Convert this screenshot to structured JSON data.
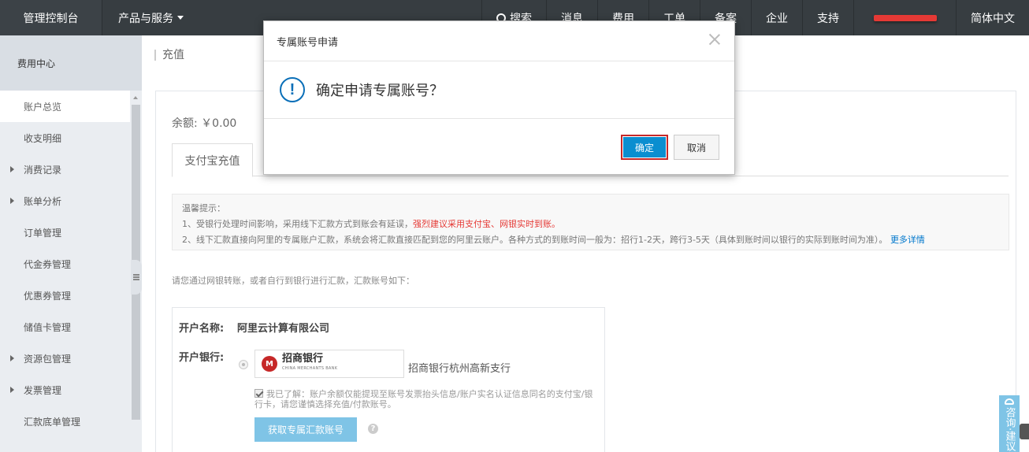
{
  "topbar": {
    "brand": "管理控制台",
    "products": "产品与服务",
    "search": "搜索",
    "items": [
      "消息",
      "费用",
      "工单",
      "备案",
      "企业",
      "支持"
    ],
    "language": "简体中文"
  },
  "sidebar": {
    "title": "费用中心",
    "items": [
      {
        "label": "账户总览",
        "expandable": false,
        "active": true
      },
      {
        "label": "收支明细",
        "expandable": false
      },
      {
        "label": "消费记录",
        "expandable": true
      },
      {
        "label": "账单分析",
        "expandable": true
      },
      {
        "label": "订单管理",
        "expandable": false
      },
      {
        "label": "代金券管理",
        "expandable": false
      },
      {
        "label": "优惠券管理",
        "expandable": false
      },
      {
        "label": "储值卡管理",
        "expandable": false
      },
      {
        "label": "资源包管理",
        "expandable": true
      },
      {
        "label": "发票管理",
        "expandable": true
      },
      {
        "label": "汇款底单管理",
        "expandable": false
      }
    ]
  },
  "main": {
    "breadcrumb": "充值",
    "balance": "余额: ￥0.00",
    "tab": "支付宝充值",
    "notice": {
      "title": "温馨提示：",
      "line1_a": "1、受银行处理时间影响，采用线下汇款方式到账会有延误，",
      "line1_red": "强烈建议采用支付宝、网银实时到账。",
      "line2": "2、线下汇款直接向阿里的专属账户汇款，系统会将汇款直接匹配到您的阿里云账户。各种方式的到账时间一般为：招行1-2天，跨行3-5天（具体到账时间以银行的实际到账时间为准）。",
      "more": "更多详情"
    },
    "instruction": "请您通过网银转账，或者自行到银行进行汇款，汇款账号如下：",
    "account": {
      "name_label": "开户名称:",
      "name_value": "阿里云计算有限公司",
      "bank_label": "开户银行:",
      "bank_logo_cn": "招商银行",
      "bank_logo_en": "CHINA MERCHANTS BANK",
      "bank_branch": "招商银行杭州高新支行",
      "agree_text": "我已了解：账户余额仅能提现至账号发票抬头信息/账户实名认证信息同名的支付宝/银行卡，请您谨慎选择充值/付款账号。",
      "get_button": "获取专属汇款账号"
    }
  },
  "dialog": {
    "title": "专属账号申请",
    "message": "确定申请专属账号？",
    "ok": "确定",
    "cancel": "取消"
  },
  "widget": {
    "consult": "咨询·建议"
  }
}
